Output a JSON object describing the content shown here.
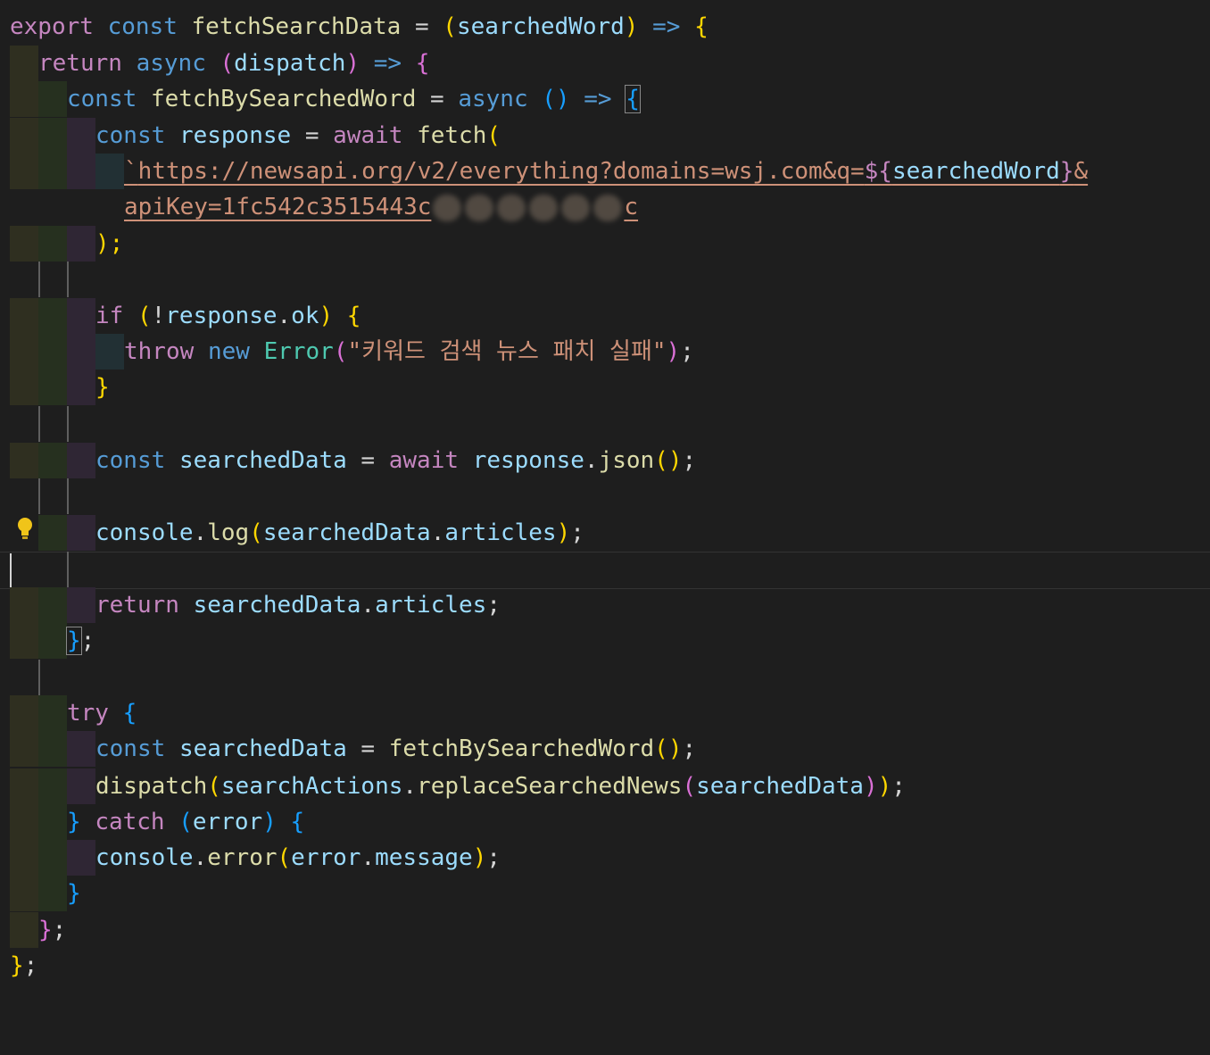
{
  "lines": {
    "l1": {
      "export": "export",
      "const": "const",
      "name": "fetchSearchData",
      "eq": " = ",
      "po": "(",
      "param": "searchedWord",
      "pc": ")",
      "arrow": " => ",
      "brace": "{"
    },
    "l2": {
      "return": "return",
      "async": "async",
      "po": "(",
      "param": "dispatch",
      "pc": ")",
      "arrow": " => ",
      "brace": "{"
    },
    "l3": {
      "const": "const",
      "name": "fetchBySearchedWord",
      "eq": " = ",
      "async": "async",
      "parens": "()",
      "arrow": " => ",
      "brace": "{"
    },
    "l4": {
      "const": "const",
      "name": "response",
      "eq": " = ",
      "await": "await",
      "fn": "fetch",
      "po": "("
    },
    "l5": {
      "tick": "`",
      "url": "https://newsapi.org/v2/everything?domains=wsj.com&q=",
      "tpl_open": "${",
      "tpl_var": "searchedWord",
      "tpl_close": "}",
      "amp": "&"
    },
    "l6": {
      "apikey": "apiKey=1fc542c3515443c",
      "tail": "c"
    },
    "l7": {
      "close": ");"
    },
    "l8": {
      "if": "if",
      "po": "(",
      "bang": "!",
      "obj": "response",
      "dot": ".",
      "prop": "ok",
      "pc": ")",
      "brace": "{"
    },
    "l9": {
      "throw": "throw",
      "new": "new",
      "cls": "Error",
      "po": "(",
      "str": "\"키워드 검색 뉴스 패치 실패\"",
      "pc": ")",
      "semi": ";"
    },
    "l10": {
      "brace": "}"
    },
    "l11": {
      "const": "const",
      "name": "searchedData",
      "eq": " = ",
      "await": "await",
      "obj": "response",
      "dot": ".",
      "fn": "json",
      "parens": "()",
      "semi": ";"
    },
    "l12": {
      "obj": "console",
      "dot": ".",
      "fn": "log",
      "po": "(",
      "arg": "searchedData",
      "dot2": ".",
      "prop": "articles",
      "pc": ")",
      "semi": ";"
    },
    "l13": {
      "return": "return",
      "obj": "searchedData",
      "dot": ".",
      "prop": "articles",
      "semi": ";"
    },
    "l14": {
      "brace": "}",
      "semi": ";"
    },
    "l15": {
      "try": "try",
      "brace": "{"
    },
    "l16": {
      "const": "const",
      "name": "searchedData",
      "eq": " = ",
      "fn": "fetchBySearchedWord",
      "parens": "()",
      "semi": ";"
    },
    "l17": {
      "fn": "dispatch",
      "po": "(",
      "obj": "searchActions",
      "dot": ".",
      "method": "replaceSearchedNews",
      "po2": "(",
      "arg": "searchedData",
      "pc2": ")",
      "pc": ")",
      "semi": ";"
    },
    "l18": {
      "brace": "}",
      "catch": "catch",
      "po": "(",
      "param": "error",
      "pc": ")",
      "brace2": "{"
    },
    "l19": {
      "obj": "console",
      "dot": ".",
      "fn": "error",
      "po": "(",
      "arg": "error",
      "dot2": ".",
      "prop": "message",
      "pc": ")",
      "semi": ";"
    },
    "l20": {
      "brace": "}"
    },
    "l21": {
      "brace": "}",
      "semi": ";"
    },
    "l22": {
      "brace": "}",
      "semi": ";"
    }
  },
  "icons": {
    "lightbulb": "lightbulb-icon"
  },
  "colors": {
    "background": "#1e1e1e",
    "keyword": "#569cd6",
    "control": "#c586c0",
    "function": "#dcdcaa",
    "variable": "#9cdcfe",
    "string": "#ce9178",
    "class": "#4ec9b0",
    "bracket1": "#ffd700",
    "bracket2": "#da70d6",
    "bracket3": "#179fff"
  }
}
